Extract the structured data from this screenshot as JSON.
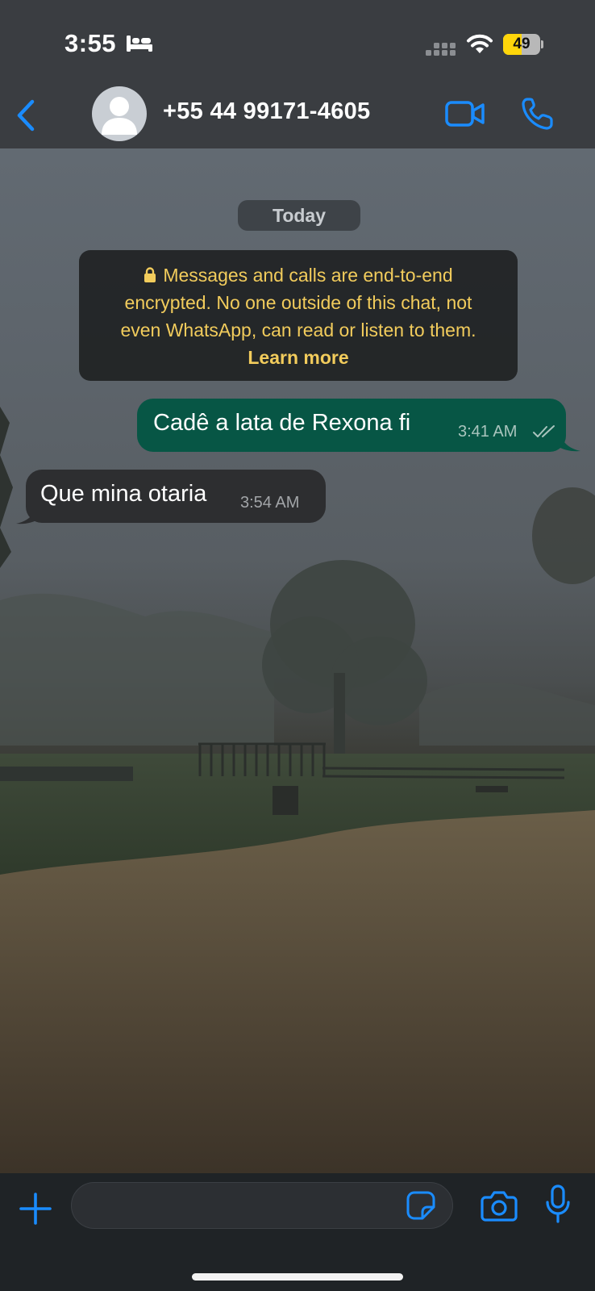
{
  "status_bar": {
    "time": "3:55",
    "battery_level": "49",
    "battery_fraction": 0.49,
    "focus_icon": "bed-icon",
    "signal_icon": "signal-icon",
    "wifi_icon": "wifi-icon"
  },
  "nav": {
    "back_icon": "chevron-left-icon",
    "contact_name": "+55 44 99171-4605",
    "video_call_icon": "video-camera-icon",
    "voice_call_icon": "phone-icon"
  },
  "chat": {
    "date_label": "Today",
    "encryption_notice": {
      "line1": "Messages and calls are end-to-end",
      "line2": "encrypted. No one outside of this chat, not",
      "line3": "even WhatsApp, can read or listen to them.",
      "link": "Learn more"
    },
    "messages": [
      {
        "direction": "outgoing",
        "text": "Cadê a lata de Rexona fi",
        "time": "3:41 AM",
        "status": "read"
      },
      {
        "direction": "incoming",
        "text": "Que mina otaria",
        "time": "3:54 AM"
      }
    ]
  },
  "composer": {
    "input_value": "",
    "placeholder": "",
    "attach_icon": "plus-icon",
    "sticker_icon": "sticker-icon",
    "camera_icon": "camera-icon",
    "mic_icon": "microphone-icon"
  },
  "colors": {
    "accent": "#1a8cff",
    "outgoing_bubble": "#075645",
    "incoming_bubble": "#2d2e30",
    "notice_text": "#f2cc5c",
    "header_bg": "#3a3d41"
  }
}
